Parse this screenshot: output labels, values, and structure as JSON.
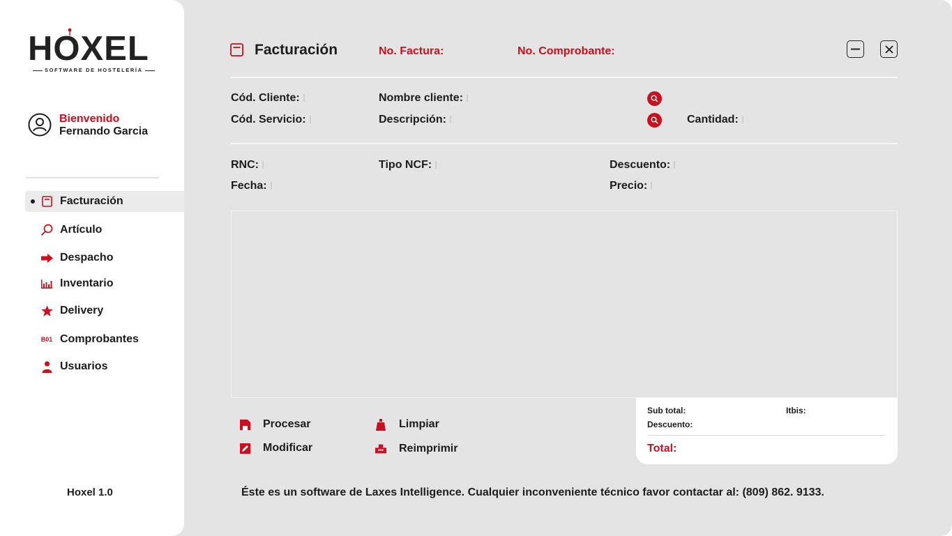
{
  "brand": {
    "logo_text": "HOXEL",
    "logo_tagline": "SOFTWARE DE HOSTELERÍA",
    "accent_color": "#c8101e"
  },
  "user": {
    "greeting": "Bienvenido",
    "name": "Fernando Garcia"
  },
  "sidebar": {
    "items": [
      {
        "label": "Facturación",
        "icon": "invoice-icon",
        "active": true
      },
      {
        "label": "Artículo",
        "icon": "search-tool-icon",
        "active": false
      },
      {
        "label": "Despacho",
        "icon": "arrow-right-icon",
        "active": false
      },
      {
        "label": "Inventario",
        "icon": "bar-chart-icon",
        "active": false
      },
      {
        "label": "Delivery",
        "icon": "star-icon",
        "active": false
      },
      {
        "label": "Comprobantes",
        "icon": "b01-icon",
        "active": false,
        "icon_text": "B01"
      },
      {
        "label": "Usuarios",
        "icon": "user-icon",
        "active": false
      }
    ],
    "version": "Hoxel 1.0"
  },
  "header": {
    "title": "Facturación",
    "invoice_no_label": "No. Factura:",
    "voucher_no_label": "No. Comprobante:"
  },
  "form": {
    "client_code": "Cód. Cliente:",
    "client_name": "Nombre cliente:",
    "service_code": "Cód. Servicio:",
    "description": "Descripción:",
    "quantity": "Cantidad:",
    "rnc": "RNC:",
    "ncf_type": "Tipo NCF:",
    "discount": "Descuento:",
    "date": "Fecha:",
    "price": "Precio:"
  },
  "actions": {
    "process": "Procesar",
    "clear": "Limpiar",
    "modify": "Modificar",
    "reprint": "Reimprimir"
  },
  "totals": {
    "subtotal": "Sub total:",
    "itbis": "Itbis:",
    "discount": "Descuento:",
    "total": "Total:"
  },
  "footer": {
    "text": "Éste es un software de Laxes Intelligence. Cualquier inconveniente técnico favor contactar al:  (809) 862. 9133."
  }
}
